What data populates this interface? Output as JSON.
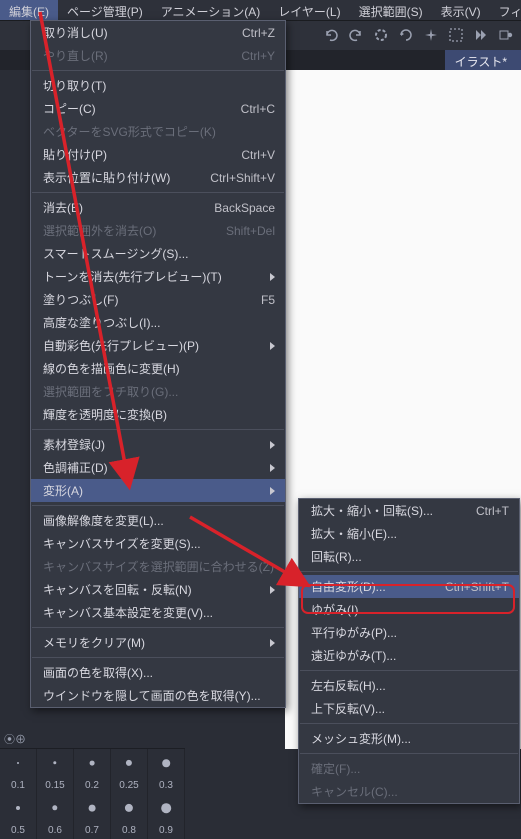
{
  "menubar": {
    "edit": "編集(E)",
    "page": "ページ管理(P)",
    "anim": "アニメーション(A)",
    "layer": "レイヤー(L)",
    "select": "選択範囲(S)",
    "view": "表示(V)",
    "filter": "フィルター(I)"
  },
  "tabs": {
    "active": "イラスト*"
  },
  "ruler": {
    "label": "⦿⊕"
  },
  "edit_menu": [
    {
      "kind": "item",
      "label": "取り消し(U)",
      "shortcut": "Ctrl+Z"
    },
    {
      "kind": "item",
      "label": "やり直し(R)",
      "shortcut": "Ctrl+Y",
      "disabled": true
    },
    {
      "kind": "sep"
    },
    {
      "kind": "item",
      "label": "切り取り(T)"
    },
    {
      "kind": "item",
      "label": "コピー(C)",
      "shortcut": "Ctrl+C"
    },
    {
      "kind": "item",
      "label": "ベクターをSVG形式でコピー(K)",
      "disabled": true
    },
    {
      "kind": "item",
      "label": "貼り付け(P)",
      "shortcut": "Ctrl+V"
    },
    {
      "kind": "item",
      "label": "表示位置に貼り付け(W)",
      "shortcut": "Ctrl+Shift+V"
    },
    {
      "kind": "sep"
    },
    {
      "kind": "item",
      "label": "消去(E)",
      "shortcut": "BackSpace"
    },
    {
      "kind": "item",
      "label": "選択範囲外を消去(O)",
      "shortcut": "Shift+Del",
      "disabled": true
    },
    {
      "kind": "item",
      "label": "スマートスムージング(S)..."
    },
    {
      "kind": "item",
      "label": "トーンを消去(先行プレビュー)(T)",
      "submenu": true
    },
    {
      "kind": "item",
      "label": "塗りつぶし(F)",
      "shortcut": "F5"
    },
    {
      "kind": "item",
      "label": "高度な塗りつぶし(I)..."
    },
    {
      "kind": "item",
      "label": "自動彩色(先行プレビュー)(P)",
      "submenu": true
    },
    {
      "kind": "item",
      "label": "線の色を描画色に変更(H)"
    },
    {
      "kind": "item",
      "label": "選択範囲をフチ取り(G)...",
      "disabled": true
    },
    {
      "kind": "item",
      "label": "輝度を透明度に変換(B)"
    },
    {
      "kind": "sep"
    },
    {
      "kind": "item",
      "label": "素材登録(J)",
      "submenu": true
    },
    {
      "kind": "item",
      "label": "色調補正(D)",
      "submenu": true
    },
    {
      "kind": "item",
      "label": "変形(A)",
      "submenu": true,
      "hover": true
    },
    {
      "kind": "sep"
    },
    {
      "kind": "item",
      "label": "画像解像度を変更(L)..."
    },
    {
      "kind": "item",
      "label": "キャンバスサイズを変更(S)..."
    },
    {
      "kind": "item",
      "label": "キャンバスサイズを選択範囲に合わせる(Z)",
      "disabled": true
    },
    {
      "kind": "item",
      "label": "キャンバスを回転・反転(N)",
      "submenu": true
    },
    {
      "kind": "item",
      "label": "キャンバス基本設定を変更(V)..."
    },
    {
      "kind": "sep"
    },
    {
      "kind": "item",
      "label": "メモリをクリア(M)",
      "submenu": true
    },
    {
      "kind": "sep"
    },
    {
      "kind": "item",
      "label": "画面の色を取得(X)..."
    },
    {
      "kind": "item",
      "label": "ウインドウを隠して画面の色を取得(Y)..."
    }
  ],
  "sub_menu": [
    {
      "kind": "item",
      "label": "拡大・縮小・回転(S)...",
      "shortcut": "Ctrl+T"
    },
    {
      "kind": "item",
      "label": "拡大・縮小(E)..."
    },
    {
      "kind": "item",
      "label": "回転(R)..."
    },
    {
      "kind": "sep"
    },
    {
      "kind": "item",
      "label": "自由変形(D)...",
      "shortcut": "Ctrl+Shift+T",
      "hover": true
    },
    {
      "kind": "item",
      "label": "ゆがみ(I)..."
    },
    {
      "kind": "item",
      "label": "平行ゆがみ(P)..."
    },
    {
      "kind": "item",
      "label": "遠近ゆがみ(T)..."
    },
    {
      "kind": "sep"
    },
    {
      "kind": "item",
      "label": "左右反転(H)..."
    },
    {
      "kind": "item",
      "label": "上下反転(V)..."
    },
    {
      "kind": "sep"
    },
    {
      "kind": "item",
      "label": "メッシュ変形(M)..."
    },
    {
      "kind": "sep"
    },
    {
      "kind": "item",
      "label": "確定(F)...",
      "disabled": true
    },
    {
      "kind": "item",
      "label": "キャンセル(C)...",
      "disabled": true
    }
  ],
  "brush_sizes": {
    "row1": [
      "0.1",
      "0.15",
      "0.2",
      "0.25",
      "0.3"
    ],
    "row2": [
      "0.5",
      "0.6",
      "0.7",
      "0.8",
      "0.9"
    ]
  },
  "colors": {
    "highlight": "#d8222a",
    "menu_hover": "#4a5b8a"
  }
}
